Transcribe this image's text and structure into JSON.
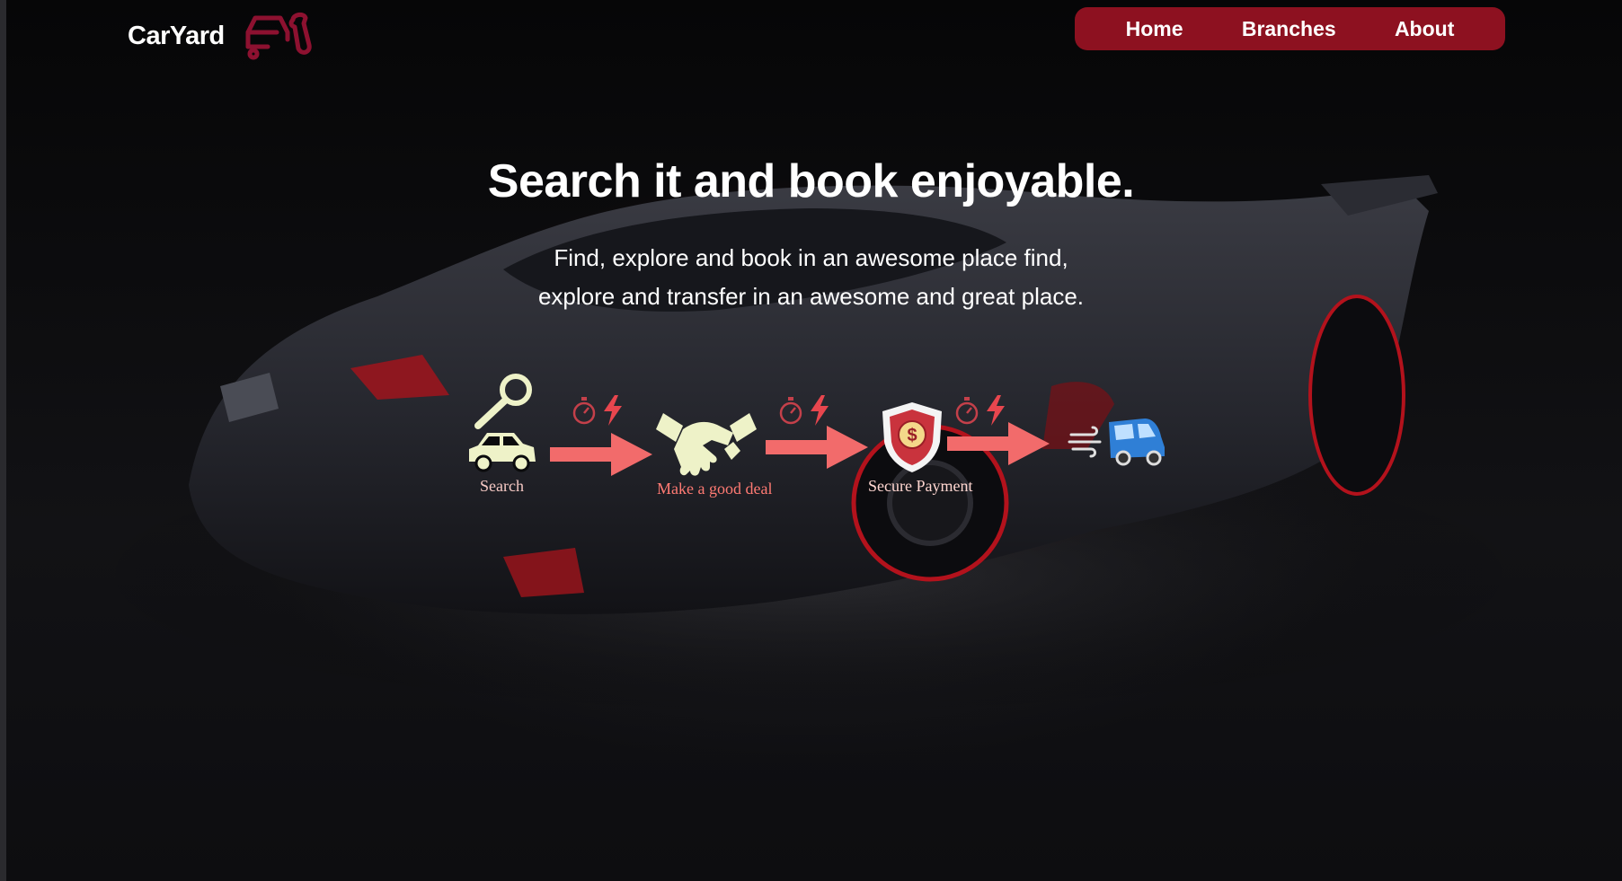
{
  "header": {
    "brand": "CarYard",
    "brand_icon": "car-wrench-icon",
    "nav": [
      {
        "label": "Home"
      },
      {
        "label": "Branches"
      },
      {
        "label": "About"
      }
    ]
  },
  "hero": {
    "title": "Search it and book enjoyable.",
    "subtitle_line1": "Find, explore and book in an awesome place find,",
    "subtitle_line2": "explore and transfer in an awesome and great place."
  },
  "steps": [
    {
      "label": "Search",
      "icon": "car-search-icon",
      "label_color": "#f6c9c4"
    },
    {
      "label": "Make a good deal",
      "icon": "handshake-icon",
      "label_color": "#ff7a73"
    },
    {
      "label": "Secure Payment",
      "icon": "secure-payment-shield-icon",
      "label_color": "#ffd6d0"
    }
  ],
  "transitions": [
    {
      "icons": [
        "stopwatch-icon",
        "lightning-icon"
      ]
    },
    {
      "icons": [
        "stopwatch-icon",
        "lightning-icon"
      ]
    },
    {
      "icons": [
        "stopwatch-icon",
        "lightning-icon"
      ]
    }
  ],
  "final_icon": "delivery-car-icon",
  "colors": {
    "accent": "#8d1120",
    "arrow": "#f26b6b",
    "icon_cream": "#eef2c8",
    "background": "#0b0b0d"
  }
}
